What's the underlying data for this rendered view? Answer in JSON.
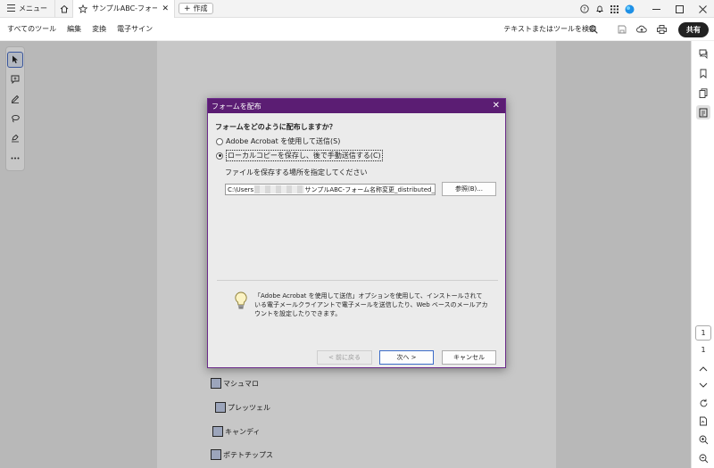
{
  "tabbar": {
    "menu_label": "メニュー",
    "doc_tab_title": "サンプルABC-フォーム...",
    "new_tab_label": "作成"
  },
  "toolbar": {
    "items": [
      "すべてのツール",
      "編集",
      "変換",
      "電子サイン"
    ],
    "search_label": "テキストまたはツールを検索",
    "share_label": "共有"
  },
  "document": {
    "items": [
      "マシュマロ",
      "プレッツェル",
      "キャンディ",
      "ポテトチップス"
    ]
  },
  "page_nav": {
    "current": "1",
    "total": "1"
  },
  "dialog": {
    "title": "フォームを配布",
    "question": "フォームをどのように配布しますか？",
    "option1": "Adobe Acrobat を使用して送信(S)",
    "option2": "ローカルコピーを保存し、後で手動送信する(C)",
    "selected_option": 2,
    "save_location_label": "ファイルを保存する場所を指定してください",
    "path_prefix": "C:\\Users",
    "path_suffix": "サンプルABC-フォーム名称変更_distributed_",
    "browse_label": "参照(B)...",
    "info_text": "「Adobe Acrobat を使用して送信」オプションを使用して、インストールされている電子メールクライアントで電子メールを送信したり、Web ベースのメールアカウントを設定したりできます。",
    "back_label": "< 前に戻る",
    "next_label": "次へ >",
    "cancel_label": "キャンセル"
  },
  "colors": {
    "dialog_title_bg": "#5b1d73",
    "dialog_border": "#6b2b8a",
    "share_bg": "#222222"
  }
}
